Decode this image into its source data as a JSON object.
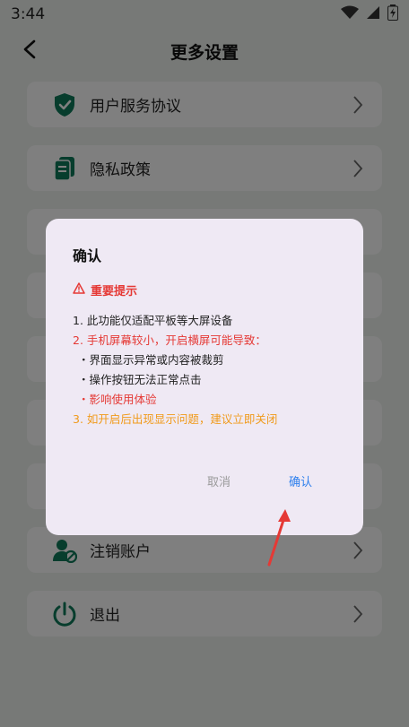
{
  "status": {
    "time": "3:44"
  },
  "header": {
    "title": "更多设置"
  },
  "list": {
    "items": [
      {
        "label": "用户服务协议",
        "icon": "shield-check-icon"
      },
      {
        "label": "隐私政策",
        "icon": "document-icon"
      },
      {
        "label": "",
        "icon": ""
      },
      {
        "label": "",
        "icon": ""
      },
      {
        "label": "",
        "icon": ""
      },
      {
        "label": "",
        "icon": ""
      },
      {
        "label": "",
        "icon": ""
      },
      {
        "label": "注销账户",
        "icon": "user-cancel-icon"
      },
      {
        "label": "退出",
        "icon": "power-icon"
      }
    ]
  },
  "dialog": {
    "title": "确认",
    "warning_title": "重要提示",
    "lines": [
      {
        "text": "1. 此功能仅适配平板等大屏设备",
        "color": "#222222"
      },
      {
        "text": "2. 手机屏幕较小，开启横屏可能导致：",
        "color": "#e53935"
      },
      {
        "text": "・界面显示异常或内容被裁剪",
        "color": "#222222"
      },
      {
        "text": "・操作按钮无法正常点击",
        "color": "#222222"
      },
      {
        "text": "・影响使用体验",
        "color": "#e53935"
      },
      {
        "text": "3. 如开启后出现显示问题，建议立即关闭",
        "color": "#f09a1a"
      }
    ],
    "cancel_label": "取消",
    "confirm_label": "确认"
  },
  "colors": {
    "accent_green": "#0f7a5a",
    "warning_red": "#e53935",
    "warning_orange": "#f09a1a",
    "link_blue": "#2f80ed"
  }
}
